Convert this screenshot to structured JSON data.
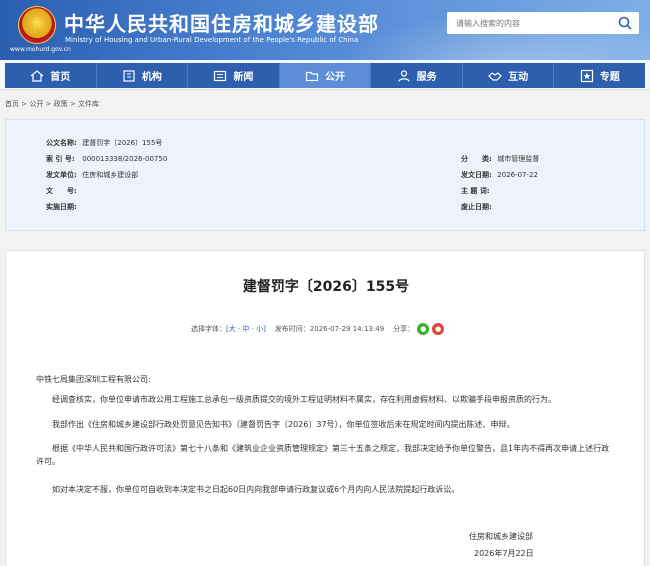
{
  "header": {
    "site_title": "中华人民共和国住房和城乡建设部",
    "site_subtitle": "Ministry of Housing and Urban-Rural Development of the People's Republic of China",
    "site_url": "www.mohurd.gov.cn",
    "search_placeholder": "请输入搜索的内容",
    "brand_color": "#2d5fae"
  },
  "nav": {
    "items": [
      {
        "label": "首页",
        "icon": "home-icon"
      },
      {
        "label": "机构",
        "icon": "building-icon"
      },
      {
        "label": "新闻",
        "icon": "newspaper-icon"
      },
      {
        "label": "公开",
        "icon": "folder-icon",
        "active": true
      },
      {
        "label": "服务",
        "icon": "person-icon"
      },
      {
        "label": "互动",
        "icon": "handshake-icon"
      },
      {
        "label": "专题",
        "icon": "star-icon"
      }
    ]
  },
  "breadcrumb": "首页 > 公开 > 政策 > 文件库",
  "info": {
    "left": [
      {
        "key": "公文名称:",
        "value": "建督罚字〔2026〕155号"
      },
      {
        "key": "索 引 号:",
        "value": "000013338/2026-00750"
      },
      {
        "key": "发文单位:",
        "value": "住房和城乡建设部"
      },
      {
        "key": "文　　号:",
        "value": ""
      },
      {
        "key": "实施日期:",
        "value": ""
      }
    ],
    "right": [
      {
        "key": "分　　类:",
        "value": "城市管理监督"
      },
      {
        "key": "发文日期:",
        "value": "2026-07-22"
      },
      {
        "key": "主 题 词:",
        "value": ""
      },
      {
        "key": "废止日期:",
        "value": ""
      }
    ]
  },
  "article": {
    "title": "建督罚字〔2026〕155号",
    "font_size_label": "选择字体：",
    "font_size_options": "[大 · 中 · 小]",
    "publish_label": "发布时间：",
    "publish_time": "2026-07-29 14:13:49",
    "share_label": "分享：",
    "recipient": "中铁七局集团深圳工程有限公司:",
    "paragraphs": [
      "经调查核实，你单位申请市政公用工程施工总承包一级资质提交的境外工程证明材料不属实，存在利用虚假材料、以欺骗手段申报资质的行为。",
      "我部作出《住房和城乡建设部行政处罚意见告知书》（建督罚告字〔2026〕37号），你单位签收后未在规定时间内提出陈述、申辩。",
      "根据《中华人民共和国行政许可法》第七十八条和《建筑业企业资质管理规定》第三十五条之规定，我部决定给予你单位警告，且1年内不得再次申请上述行政许可。",
      "如对本决定不服，你单位可自收到本决定书之日起60日内向我部申请行政复议或6个月内向人民法院提起行政诉讼。"
    ],
    "signature_org": "住房和城乡建设部",
    "signature_date": "2026年7月22日"
  }
}
